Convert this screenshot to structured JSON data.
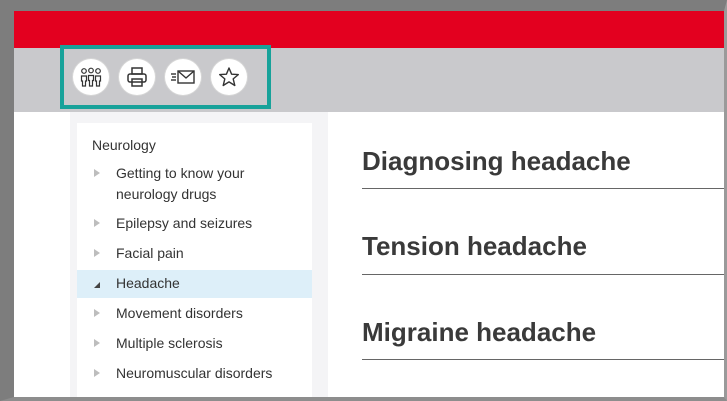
{
  "toolbar": {
    "buttons": [
      {
        "icon": "people-icon",
        "label": ""
      },
      {
        "icon": "print-icon",
        "label": ""
      },
      {
        "icon": "email-icon",
        "label": ""
      },
      {
        "icon": "star-icon",
        "label": ""
      }
    ],
    "highlight_color": "#17a29a"
  },
  "colors": {
    "brand_red": "#e3001f",
    "toolbar_bg": "#c9c9cc",
    "active_item_bg": "#ddeff9"
  },
  "sidebar": {
    "title": "Neurology",
    "items": [
      {
        "label": "Getting to know your neurology drugs",
        "state": "collapsed"
      },
      {
        "label": "Epilepsy and seizures",
        "state": "collapsed"
      },
      {
        "label": "Facial pain",
        "state": "collapsed"
      },
      {
        "label": "Headache",
        "state": "expanded"
      },
      {
        "label": "Movement disorders",
        "state": "collapsed"
      },
      {
        "label": "Multiple sclerosis",
        "state": "collapsed"
      },
      {
        "label": "Neuromuscular disorders",
        "state": "collapsed"
      }
    ]
  },
  "main": {
    "sections": [
      {
        "title": "Diagnosing headache"
      },
      {
        "title": "Tension headache"
      },
      {
        "title": "Migraine headache"
      }
    ]
  }
}
